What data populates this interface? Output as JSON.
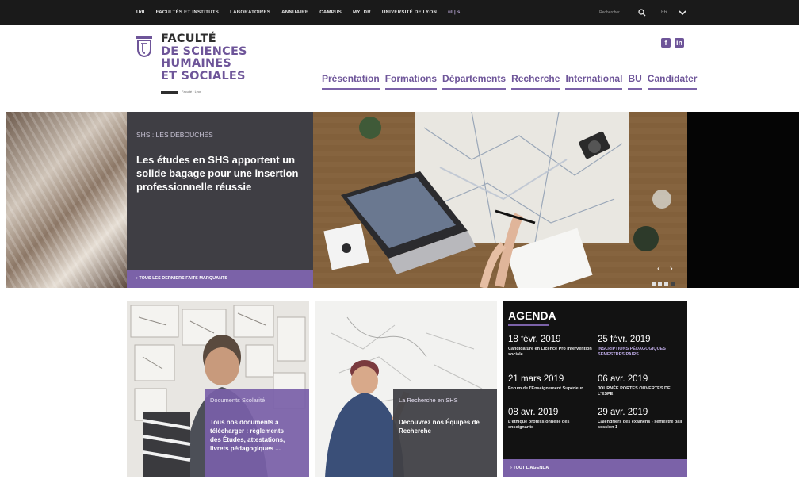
{
  "colors": {
    "brand": "#6e5599",
    "accent": "#7b62a8",
    "topbar": "#1a1a1a",
    "panel": "#3f3e44"
  },
  "topbar": {
    "links": [
      "UdI",
      "FACULTÉS ET INSTITUTS",
      "LABORATOIRES",
      "ANNUAIRE",
      "CAMPUS",
      "MYLDR",
      "UNIVERSITÉ DE LYON",
      "ul | s"
    ],
    "search_placeholder": "Rechercher",
    "language": "FR"
  },
  "header": {
    "logo_lines": [
      "FACULTÉ",
      "DE SCIENCES",
      "HUMAINES",
      "ET SOCIALES"
    ],
    "logo_sub": "Faculté · Lyon",
    "social": [
      "facebook-icon",
      "linkedin-icon"
    ],
    "nav": [
      "Présentation",
      "Formations",
      "Départements",
      "Recherche",
      "International",
      "BU",
      "Candidater"
    ]
  },
  "hero": {
    "kicker": "SHS : LES DÉBOUCHÉS",
    "title": "Les études en SHS apportent un solide bagage pour une insertion professionnelle réussie",
    "link": "› TOUS LES DERNIERS FAITS MARQUANTS",
    "prev": "‹",
    "next": "›",
    "dots": 4
  },
  "cards": [
    {
      "kicker": "Documents Scolarité",
      "text": "Tous nos documents à télécharger : règlements des Études, attestations, livrets pédagogiques ..."
    },
    {
      "kicker": "La Recherche en SHS",
      "text": "Découvrez nos Équipes de Recherche"
    }
  ],
  "agenda": {
    "title": "AGENDA",
    "events": [
      {
        "date": "18 févr. 2019",
        "title": "Candidature en Licence Pro Intervention sociale",
        "highlight": false
      },
      {
        "date": "25 févr. 2019",
        "title": "INSCRIPTIONS PÉDAGOGIQUES SEMESTRES PAIRS",
        "highlight": true
      },
      {
        "date": "21 mars 2019",
        "title": "Forum de l'Enseignement Supérieur",
        "highlight": false
      },
      {
        "date": "06 avr. 2019",
        "title": "JOURNÉE PORTES OUVERTES DE L'ESPE",
        "highlight": false
      },
      {
        "date": "08 avr. 2019",
        "title": "L'éthique professionnelle des enseignants",
        "highlight": false
      },
      {
        "date": "29 avr. 2019",
        "title": "Calendriers des examens - semestre pair session 1",
        "highlight": false
      }
    ],
    "link": "› TOUT L'AGENDA"
  }
}
